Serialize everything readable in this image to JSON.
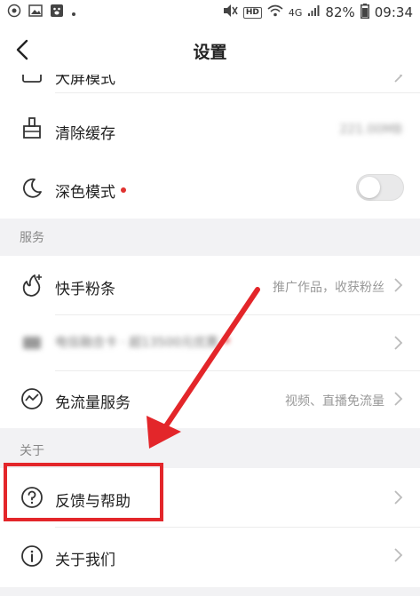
{
  "status_bar": {
    "battery": "82%",
    "time": "09:34",
    "network_type": "4G",
    "hd_badge": "HD"
  },
  "nav": {
    "title": "设置"
  },
  "sections": [
    {
      "items": [
        {
          "label": "大屏模式",
          "icon": "screen-icon",
          "partially_visible": true
        },
        {
          "label": "清除缓存",
          "icon": "broom-icon",
          "value": "221.00MB"
        },
        {
          "label": "深色模式",
          "icon": "moon-icon",
          "toggle": false,
          "red_dot": true
        }
      ]
    },
    {
      "header": "服务",
      "items": [
        {
          "label": "快手粉条",
          "icon": "fans-icon",
          "value": "推广作品，收获粉丝"
        },
        {
          "label": "电信融合卡 · 超13500元优惠",
          "icon": "card-icon",
          "blurred": true,
          "red_dot": true
        },
        {
          "label": "免流量服务",
          "icon": "traffic-icon",
          "value": "视频、直播免流量"
        }
      ]
    },
    {
      "header": "关于",
      "items": [
        {
          "label": "反馈与帮助",
          "icon": "help-icon"
        },
        {
          "label": "关于我们",
          "icon": "info-icon"
        }
      ]
    }
  ],
  "annotation": {
    "highlight_color": "#e3262a"
  }
}
